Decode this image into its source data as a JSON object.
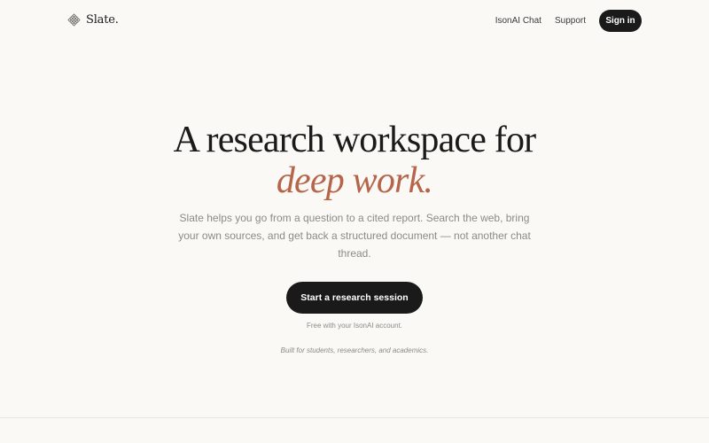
{
  "header": {
    "brand": "Slate.",
    "brand_icon": "lattice-diamond-icon",
    "nav": [
      {
        "label": "IsonAI Chat"
      },
      {
        "label": "Support"
      }
    ],
    "signin_label": "Sign in"
  },
  "hero": {
    "headline": "A research workspace for",
    "headline_accent": "deep work.",
    "subtitle": "Slate helps you go from a question to a cited report. Search the web, bring your own sources, and get back a structured document — not another chat thread.",
    "cta_label": "Start a research session",
    "cta_note": "Free with your IsonAI account.",
    "audience": "Built for students, researchers, and academics."
  },
  "colors": {
    "background": "#faf9f6",
    "text": "#1a1a1a",
    "accent": "#b6654a",
    "muted": "#8b8b86",
    "button": "#1a1a1a"
  }
}
